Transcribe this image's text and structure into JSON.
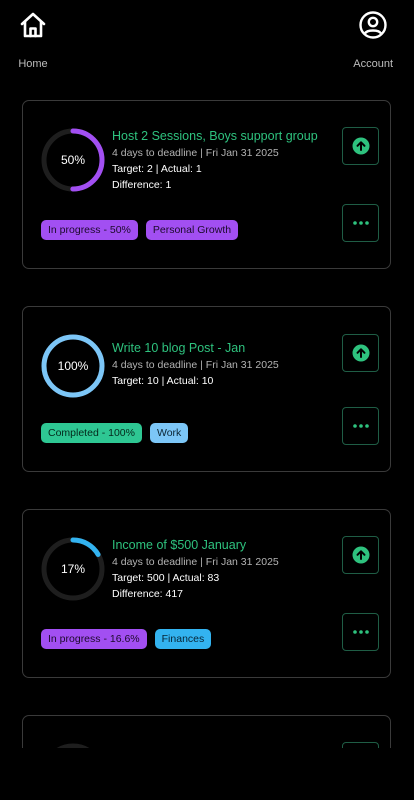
{
  "nav": {
    "home_label": "Home",
    "home_icon": "home-icon",
    "account_label": "Account",
    "account_icon": "user-circle-icon"
  },
  "colors": {
    "accent_green": "#2ec27e",
    "ring_purple": "#a24ff2",
    "ring_blue": "#7cc6f7",
    "ring_sky": "#33b3f0",
    "overdue_red": "#e0414b"
  },
  "goals": [
    {
      "title": "Host 2 Sessions, Boys support group",
      "deadline": "4 days to deadline | Fri Jan 31 2025",
      "stat1": "Target: 2 | Actual: 1",
      "stat2": "Difference: 1",
      "percent_label": "50%",
      "progress": 0.5,
      "ring_color": "#a24ff2",
      "status_badge": "In progress - 50%",
      "category_badge": "Personal Growth"
    },
    {
      "title": "Write 10 blog Post - Jan",
      "deadline": "4 days to deadline | Fri Jan 31 2025",
      "stat1": "Target: 10 | Actual: 10",
      "percent_label": "100%",
      "progress": 1.0,
      "ring_color": "#7cc6f7",
      "status_badge": "Completed - 100%",
      "category_badge": "Work"
    },
    {
      "title": "Income of $500 January",
      "deadline": "4 days to deadline | Fri Jan 31 2025",
      "stat1": "Target: 500 | Actual: 83",
      "stat2": "Difference: 417",
      "percent_label": "17%",
      "progress": 0.166,
      "ring_color": "#33b3f0",
      "status_badge": "In progress - 16.6%",
      "category_badge": "Finances"
    }
  ],
  "buttons": {
    "upload_icon": "arrow-up-circle-icon",
    "more_icon": "more-dots-icon"
  }
}
